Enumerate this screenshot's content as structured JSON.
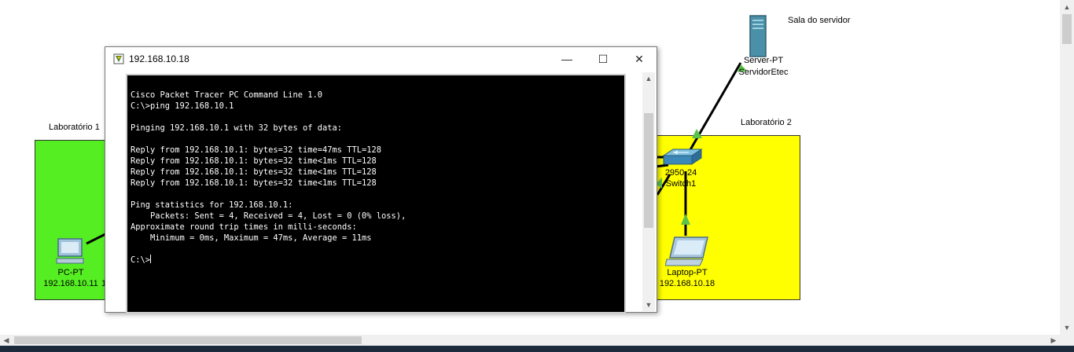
{
  "workspace": {
    "lab1_label": "Laboratório 1",
    "lab2_label": "Laboratório 2",
    "server_room_label": "Sala do servidor",
    "lab1_color": "#55ee22",
    "lab2_color": "#ffff00",
    "devices": {
      "pc": {
        "type": "PC-PT",
        "ip": "192.168.10.11",
        "ip_cut_suffix": "1",
        "icon": "pc-icon"
      },
      "laptop": {
        "type": "Laptop-PT",
        "ip": "192.168.10.18",
        "icon": "laptop-icon"
      },
      "switch": {
        "type": "2950-24",
        "name": "Switch1",
        "icon": "switch-icon"
      },
      "server": {
        "type": "Server-PT",
        "name": "ServidorEtec",
        "icon": "server-icon"
      }
    },
    "link_color": "#000000",
    "link_status_color": "#5cc24a"
  },
  "cmd_window": {
    "title": "192.168.10.18",
    "minimize_glyph": "—",
    "maximize_glyph": "☐",
    "close_glyph": "✕",
    "terminal_lines": [
      "Cisco Packet Tracer PC Command Line 1.0",
      "C:\\>ping 192.168.10.1",
      "",
      "Pinging 192.168.10.1 with 32 bytes of data:",
      "",
      "Reply from 192.168.10.1: bytes=32 time=47ms TTL=128",
      "Reply from 192.168.10.1: bytes=32 time<1ms TTL=128",
      "Reply from 192.168.10.1: bytes=32 time<1ms TTL=128",
      "Reply from 192.168.10.1: bytes=32 time<1ms TTL=128",
      "",
      "Ping statistics for 192.168.10.1:",
      "    Packets: Sent = 4, Received = 4, Lost = 0 (0% loss),",
      "Approximate round trip times in milli-seconds:",
      "    Minimum = 0ms, Maximum = 47ms, Average = 11ms",
      ""
    ],
    "prompt": "C:\\>"
  },
  "scrollbars": {
    "up_glyph": "▲",
    "down_glyph": "▼",
    "left_glyph": "◀",
    "right_glyph": "▶"
  }
}
